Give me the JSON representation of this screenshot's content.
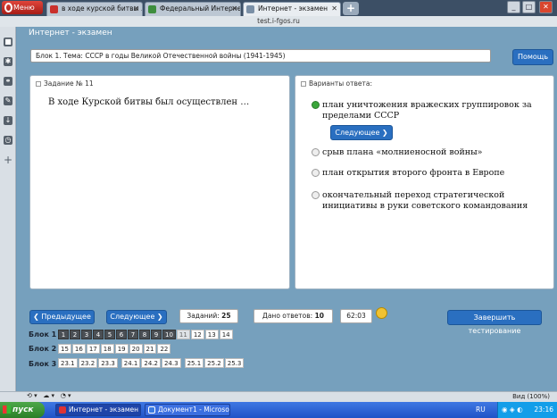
{
  "browser": {
    "menu_label": "Меню",
    "tabs": [
      {
        "title": "в ходе курской битвы ..."
      },
      {
        "title": "Федеральный Интерне..."
      },
      {
        "title": "Интернет - экзамен"
      }
    ],
    "url": "test.i-fgos.ru",
    "zoom": "Вид (100%)",
    "accent": "#3c4f65"
  },
  "app": {
    "title": "Интернет - экзамен",
    "block_info": "Блок 1. Тема: СССР в годы Великой Отечественной войны (1941-1945)",
    "help_label": "Помощь"
  },
  "question": {
    "header": "Задание № 11",
    "text": "В ходе Курской битвы был осуществлен …"
  },
  "answers": {
    "header": "Варианты ответа:",
    "next_label": "Следующее",
    "options": [
      {
        "text": "план уничтожения вражеских группировок за пределами СССР",
        "selected": true
      },
      {
        "text": "срыв плана «молниеносной войны»",
        "selected": false
      },
      {
        "text": "план открытия второго фронта в Европе",
        "selected": false
      },
      {
        "text": "окончательный переход стратегической инициативы в руки советского командования",
        "selected": false
      }
    ]
  },
  "controls": {
    "prev_label": "Предыдущее",
    "next_label": "Следующее",
    "tasks_label": "Заданий:",
    "tasks_count": "25",
    "answered_label": "Дано ответов:",
    "answered_count": "10",
    "timer": "62:03",
    "finish_label": "Завершить тестирование"
  },
  "blocks": [
    {
      "label": "Блок 1",
      "cells": [
        "1",
        "2",
        "3",
        "4",
        "5",
        "6",
        "7",
        "8",
        "9",
        "10",
        "11",
        "12",
        "13",
        "14"
      ]
    },
    {
      "label": "Блок 2",
      "cells": [
        "15",
        "16",
        "17",
        "18",
        "19",
        "20",
        "21",
        "22"
      ]
    },
    {
      "label": "Блок 3",
      "cells": [
        "23.1",
        "23.2",
        "23.3",
        "24.1",
        "24.2",
        "24.3",
        "25.1",
        "25.2",
        "25.3"
      ]
    }
  ],
  "taskbar": {
    "start_label": "пуск",
    "tasks": [
      {
        "title": "Интернет - экзамен ..."
      },
      {
        "title": "Документ1 - Microso..."
      }
    ],
    "lang": "RU",
    "time": "23:16"
  }
}
